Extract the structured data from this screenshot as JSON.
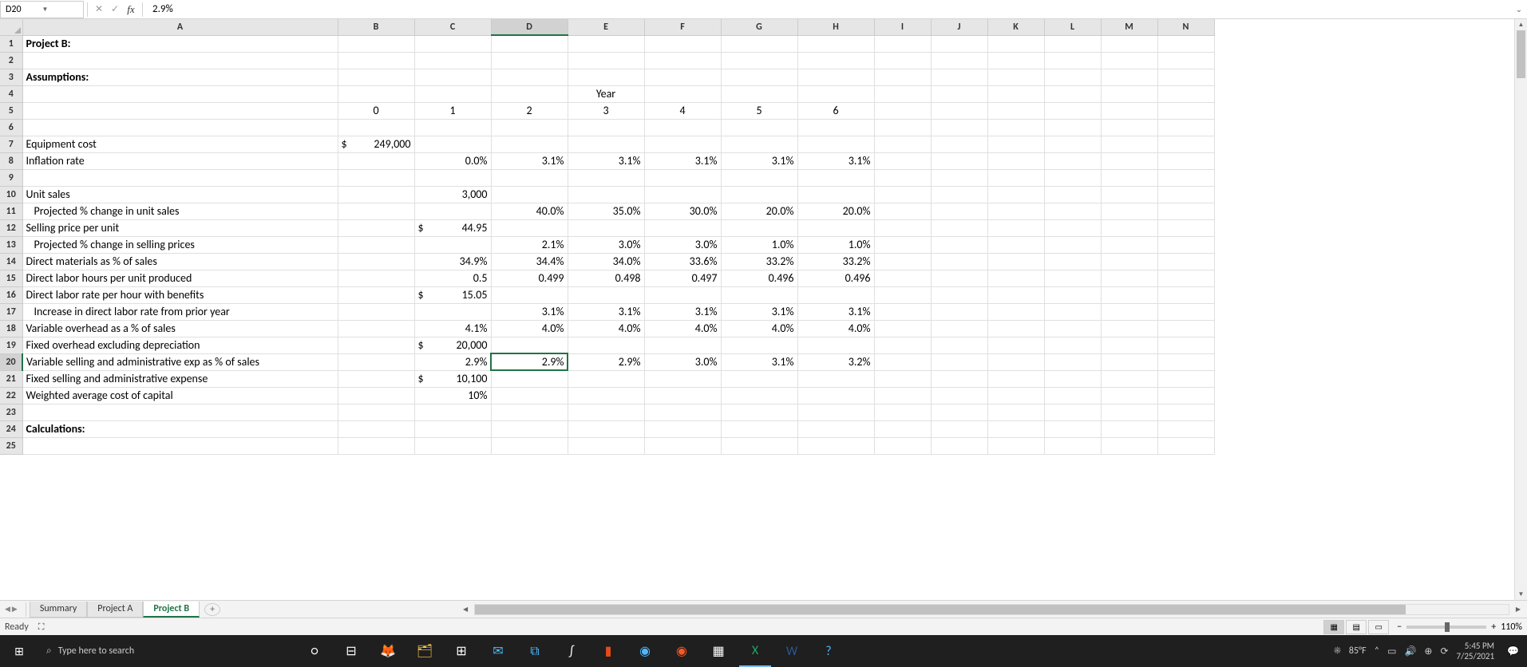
{
  "nameBox": "D20",
  "formulaValue": "2.9%",
  "activeCell": {
    "row": 20,
    "col": "D"
  },
  "columns": [
    "A",
    "B",
    "C",
    "D",
    "E",
    "F",
    "G",
    "H",
    "I",
    "J",
    "K",
    "L",
    "M",
    "N"
  ],
  "sheets": {
    "tabs": [
      "Summary",
      "Project A",
      "Project B"
    ],
    "active": "Project B"
  },
  "status": {
    "ready": "Ready",
    "zoom": "110%"
  },
  "taskbar": {
    "searchPlaceholder": "Type here to search",
    "weather": "85°F",
    "time": "5:45 PM",
    "date": "7/25/2021"
  },
  "rows": [
    {
      "n": 1,
      "A": "Project B:",
      "bold": true
    },
    {
      "n": 2
    },
    {
      "n": 3,
      "A": "Assumptions:",
      "bold": true
    },
    {
      "n": 4,
      "E": "Year",
      "eCenter": true,
      "topBorder": true
    },
    {
      "n": 5,
      "B": "0",
      "C": "1",
      "D": "2",
      "E": "3",
      "F": "4",
      "G": "5",
      "H": "6",
      "center": true
    },
    {
      "n": 6,
      "topBorder": true
    },
    {
      "n": 7,
      "A": "Equipment cost",
      "B": "249,000",
      "Bcurr": true
    },
    {
      "n": 8,
      "A": "Inflation rate",
      "C": "0.0%",
      "D": "3.1%",
      "E": "3.1%",
      "F": "3.1%",
      "G": "3.1%",
      "H": "3.1%"
    },
    {
      "n": 9
    },
    {
      "n": 10,
      "A": "Unit sales",
      "C": "3,000"
    },
    {
      "n": 11,
      "A": "Projected % change in unit sales",
      "indent": true,
      "D": "40.0%",
      "E": "35.0%",
      "F": "30.0%",
      "G": "20.0%",
      "H": "20.0%"
    },
    {
      "n": 12,
      "A": "Selling price per unit",
      "C": "44.95",
      "Ccurr": true
    },
    {
      "n": 13,
      "A": "Projected % change in selling prices",
      "indent": true,
      "D": "2.1%",
      "E": "3.0%",
      "F": "3.0%",
      "G": "1.0%",
      "H": "1.0%"
    },
    {
      "n": 14,
      "A": "Direct materials as % of sales",
      "C": "34.9%",
      "D": "34.4%",
      "E": "34.0%",
      "F": "33.6%",
      "G": "33.2%",
      "H": "33.2%"
    },
    {
      "n": 15,
      "A": "Direct labor hours per unit produced",
      "C": "0.5",
      "D": "0.499",
      "E": "0.498",
      "F": "0.497",
      "G": "0.496",
      "H": "0.496"
    },
    {
      "n": 16,
      "A": "Direct labor rate per hour with benefits",
      "C": "15.05",
      "Ccurr": true
    },
    {
      "n": 17,
      "A": "Increase in direct labor rate from prior year",
      "indent": true,
      "D": "3.1%",
      "E": "3.1%",
      "F": "3.1%",
      "G": "3.1%",
      "H": "3.1%"
    },
    {
      "n": 18,
      "A": "Variable overhead as a % of sales",
      "C": "4.1%",
      "D": "4.0%",
      "E": "4.0%",
      "F": "4.0%",
      "G": "4.0%",
      "H": "4.0%"
    },
    {
      "n": 19,
      "A": "Fixed overhead excluding depreciation",
      "C": "20,000",
      "Ccurr": true
    },
    {
      "n": 20,
      "A": "Variable selling and administrative exp as % of sales",
      "C": "2.9%",
      "D": "2.9%",
      "E": "2.9%",
      "F": "3.0%",
      "G": "3.1%",
      "H": "3.2%"
    },
    {
      "n": 21,
      "A": "Fixed selling and administrative expense",
      "C": "10,100",
      "Ccurr": true
    },
    {
      "n": 22,
      "A": "Weighted average cost of capital",
      "C": "10%"
    },
    {
      "n": 23
    },
    {
      "n": 24,
      "A": "Calculations:",
      "bold": true
    },
    {
      "n": 25
    }
  ]
}
